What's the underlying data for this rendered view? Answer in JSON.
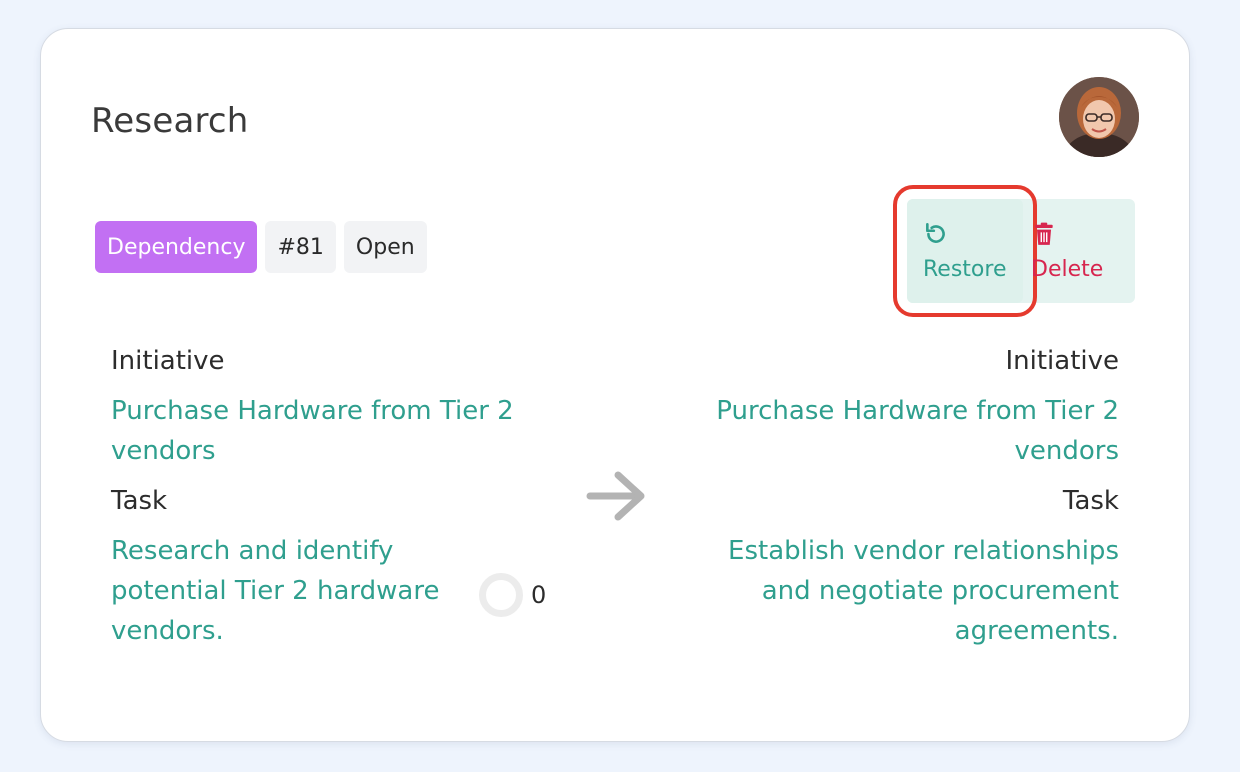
{
  "card": {
    "title": "Research",
    "avatar_alt": "user avatar"
  },
  "badges": {
    "type": "Dependency",
    "number": "#81",
    "status": "Open"
  },
  "actions": {
    "restore_label": "Restore",
    "delete_label": "Delete"
  },
  "source": {
    "initiative_label": "Initiative",
    "initiative_name": "Purchase Hardware from Tier 2 vendors",
    "task_label": "Task",
    "task_name": "Research and identify potential Tier 2 hardware vendors.",
    "progress_value": "0"
  },
  "target": {
    "initiative_label": "Initiative",
    "initiative_name": "Purchase Hardware from Tier 2 vendors",
    "task_label": "Task",
    "task_name": "Establish vendor relationships and negotiate procurement agreements."
  },
  "colors": {
    "accent": "#2f9f8e",
    "badge_purple": "#c270f3",
    "delete_red": "#d7264f",
    "highlight_red": "#e53a2e"
  }
}
